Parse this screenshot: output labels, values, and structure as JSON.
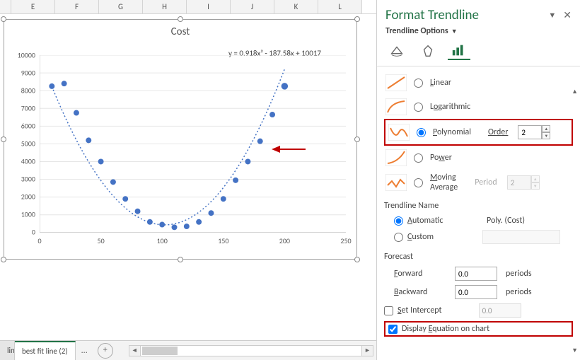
{
  "columns": [
    "E",
    "F",
    "G",
    "H",
    "I",
    "J",
    "K",
    "L"
  ],
  "chart": {
    "title": "Cost",
    "equation": "y = 0.918x² - 187.58x + 10017",
    "y_ticks": [
      0,
      1000,
      2000,
      3000,
      4000,
      5000,
      6000,
      7000,
      8000,
      9000,
      10000
    ],
    "x_ticks": [
      0,
      50,
      100,
      150,
      200,
      250
    ]
  },
  "chart_data": {
    "type": "scatter",
    "title": "Cost",
    "xlabel": "",
    "ylabel": "",
    "xlim": [
      0,
      250
    ],
    "ylim": [
      0,
      10000
    ],
    "series": [
      {
        "name": "Cost",
        "x": [
          10,
          20,
          30,
          40,
          50,
          60,
          70,
          80,
          90,
          100,
          110,
          120,
          130,
          140,
          150,
          160,
          170,
          180,
          190,
          200
        ],
        "y": [
          8250,
          8400,
          6750,
          5200,
          4000,
          2850,
          1900,
          1200,
          600,
          450,
          300,
          350,
          600,
          1100,
          1900,
          2950,
          4000,
          5150,
          6650,
          8250
        ]
      }
    ],
    "trendline": {
      "type": "polynomial",
      "order": 2,
      "equation": "y = 0.918x^2 - 187.58x + 10017"
    }
  },
  "tabs": {
    "active": "best fit line (2)",
    "cut": "line"
  },
  "panel": {
    "title": "Format Trendline",
    "subtitle": "Trendline Options",
    "types": {
      "linear": "Linear",
      "log": "Logarithmic",
      "poly": "Polynomial",
      "power": "Power",
      "mavg": "Moving Average"
    },
    "order_label": "Order",
    "order_value": "2",
    "period_label": "Period",
    "period_value": "2",
    "name_section": "Trendline Name",
    "auto": "Automatic",
    "auto_val": "Poly. (Cost)",
    "custom": "Custom",
    "forecast": "Forecast",
    "forward": "Forward",
    "backward": "Backward",
    "fval": "0.0",
    "bval": "0.0",
    "periods": "periods",
    "set_intercept": "Set Intercept",
    "si_val": "0.0",
    "disp_eq": "Display Equation on chart"
  }
}
